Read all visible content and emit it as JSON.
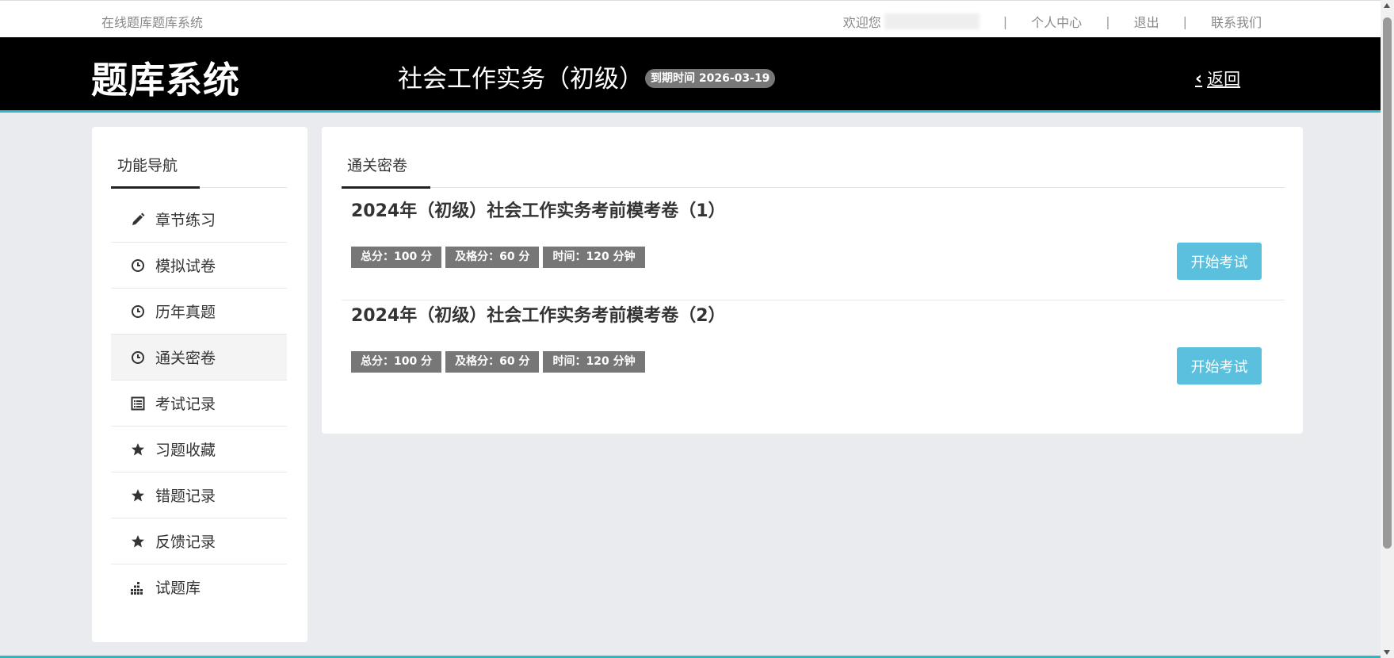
{
  "topbar": {
    "site_name": "在线题库题库系统",
    "welcome": "欢迎您",
    "personal_center": "个人中心",
    "logout": "退出",
    "contact_us": "联系我们",
    "separator": "|"
  },
  "header": {
    "brand": "题库系统",
    "subject_title": "社会工作实务（初级）",
    "expiry_badge": "到期时间 2026-03-19",
    "back_label": "返回",
    "accent_color": "#33b5c8"
  },
  "sidebar": {
    "title": "功能导航",
    "items": [
      {
        "label": "章节练习",
        "icon": "pencil-icon"
      },
      {
        "label": "模拟试卷",
        "icon": "clock-icon"
      },
      {
        "label": "历年真题",
        "icon": "clock-icon"
      },
      {
        "label": "通关密卷",
        "icon": "clock-icon",
        "active": true
      },
      {
        "label": "考试记录",
        "icon": "list-icon"
      },
      {
        "label": "习题收藏",
        "icon": "star-icon"
      },
      {
        "label": "错题记录",
        "icon": "star-icon"
      },
      {
        "label": "反馈记录",
        "icon": "star-icon"
      },
      {
        "label": "试题库",
        "icon": "bars-icon"
      }
    ]
  },
  "main": {
    "tab_label": "通关密卷",
    "exams": [
      {
        "title": "2024年（初级）社会工作实务考前模考卷（1）",
        "total": "总分：100 分",
        "pass": "及格分：60 分",
        "time": "时间：120 分钟",
        "button": "开始考试"
      },
      {
        "title": "2024年（初级）社会工作实务考前模考卷（2）",
        "total": "总分：100 分",
        "pass": "及格分：60 分",
        "time": "时间：120 分钟",
        "button": "开始考试"
      }
    ],
    "button_color": "#5bc0de"
  }
}
